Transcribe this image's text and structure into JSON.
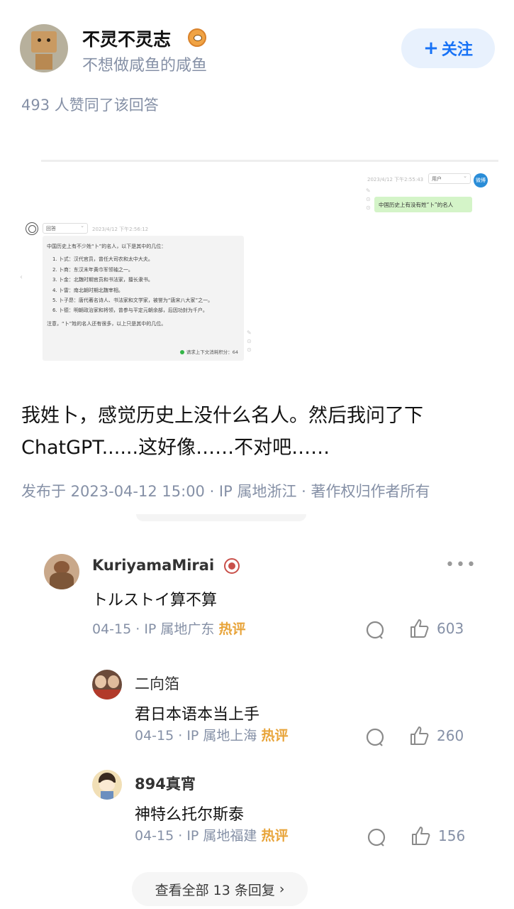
{
  "author": {
    "name": "不灵不灵志",
    "bio": "不想做咸鱼的咸鱼",
    "follow_label": "关注",
    "follow_icon": "plus-icon",
    "badge_icon": "eye-badge-icon"
  },
  "votes_text": "493 人赞同了该回答",
  "screenshot": {
    "user_time": "2023/4/12 下午2:55:43",
    "user_role": "用户",
    "user_avatar_text": "微博",
    "user_message": "中国历史上有没有姓“卜”的名人",
    "bot_role": "回答",
    "bot_time": "2023/4/12 下午2:56:12",
    "answer_lines": [
      "中国历史上有不少姓“卜”的名人，以下是其中的几位：",
      "1. 卜式：汉代官员，曾任大司农和太中大夫。",
      "2. 卜商：东汉末年黄巾军领袖之一。",
      "3. 卜金：北魏时期官员和书法家，擅长隶书。",
      "4. 卜雷：南北朝时期北魏宰相。",
      "5. 卜子昂：唐代著名诗人、书法家和文学家，被誉为“唐宋八大家”之一。",
      "6. 卜德：明朝政治家和将领，曾参与平定元朝余部，后因功封为千户。",
      "注意，“卜”姓的名人还有很多，以上只是其中的几位。"
    ],
    "token_text": "请求上下文消耗积分：64"
  },
  "answer": {
    "text_line1": "我姓卜，感觉历史上没什么名人。然后我问了下",
    "text_line2": "ChatGPT......这好像……不对吧……",
    "meta": "发布于 2023-04-12 15:00 · IP 属地浙江 · 著作权归作者所有"
  },
  "comments": [
    {
      "name": "KuriyamaMirai",
      "text": "トルストイ算不算",
      "meta": "04-15 · IP 属地广东",
      "hot": "热评",
      "likes": "603"
    },
    {
      "name": "二向箔",
      "text": "君日本语本当上手",
      "meta": "04-15 · IP 属地上海",
      "hot": "热评",
      "likes": "260"
    },
    {
      "name": "894真宵",
      "text": "神特么托尔斯泰",
      "meta": "04-15 · IP 属地福建",
      "hot": "热评",
      "likes": "156"
    }
  ],
  "view_all_label": "查看全部 13 条回复",
  "colors": {
    "accent": "#1772f6",
    "muted": "#8590a6",
    "hot": "#e8a43a"
  }
}
